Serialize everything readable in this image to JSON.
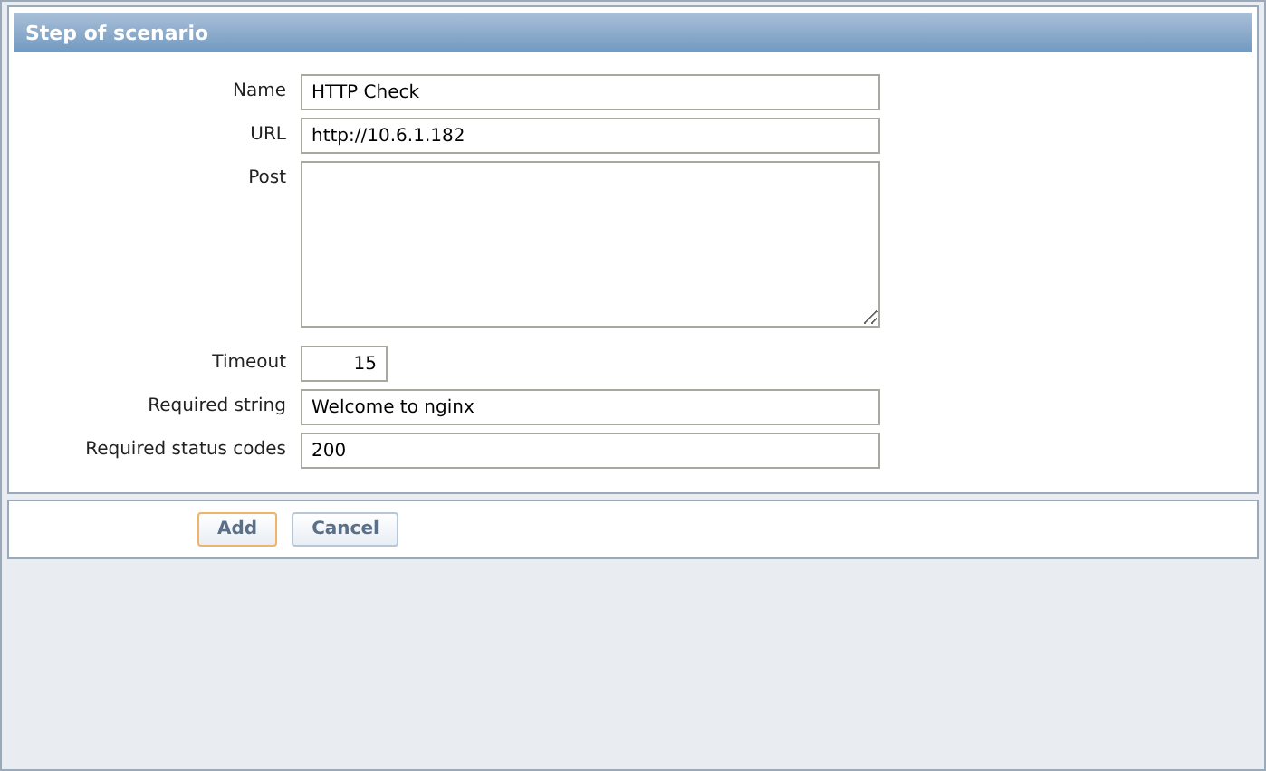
{
  "title": "Step of scenario",
  "fields": [
    {
      "label": "Name",
      "kind": "text",
      "value": "HTTP Check"
    },
    {
      "label": "URL",
      "kind": "text",
      "value": "http://10.6.1.182"
    },
    {
      "label": "Post",
      "kind": "textarea"
    },
    {
      "label": "Timeout",
      "kind": "number",
      "value": "15"
    },
    {
      "label": "Required string",
      "kind": "text",
      "value": "Welcome to nginx"
    },
    {
      "label": "Required status codes",
      "kind": "text",
      "value": "200"
    }
  ],
  "buttons": [
    {
      "label": "Add",
      "kind": "primary"
    },
    {
      "label": "Cancel",
      "kind": "secondary"
    }
  ]
}
